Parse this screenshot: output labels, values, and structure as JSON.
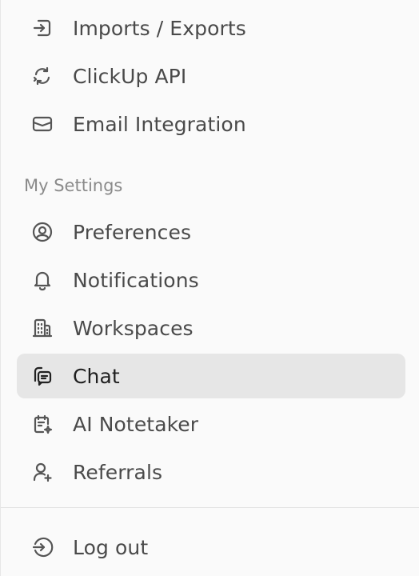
{
  "menu": {
    "top_items": [
      {
        "label": "Imports / Exports",
        "icon": "import-export-icon"
      },
      {
        "label": "ClickUp API",
        "icon": "api-refresh-icon"
      },
      {
        "label": "Email Integration",
        "icon": "email-icon"
      }
    ],
    "section_title": "My Settings",
    "settings_items": [
      {
        "label": "Preferences",
        "icon": "user-circle-icon"
      },
      {
        "label": "Notifications",
        "icon": "bell-icon"
      },
      {
        "label": "Workspaces",
        "icon": "building-icon"
      },
      {
        "label": "Chat",
        "icon": "chat-icon",
        "active": true
      },
      {
        "label": "AI Notetaker",
        "icon": "ai-notetaker-icon"
      },
      {
        "label": "Referrals",
        "icon": "user-plus-icon"
      }
    ],
    "logout": {
      "label": "Log out",
      "icon": "log-out-icon"
    }
  },
  "colors": {
    "background": "#fafafa",
    "active_background": "#e6e6e6",
    "text": "#4a4a4a",
    "active_text": "#1f1f1f",
    "section_title": "#8a8a8a",
    "divider": "#e2e2e2"
  }
}
